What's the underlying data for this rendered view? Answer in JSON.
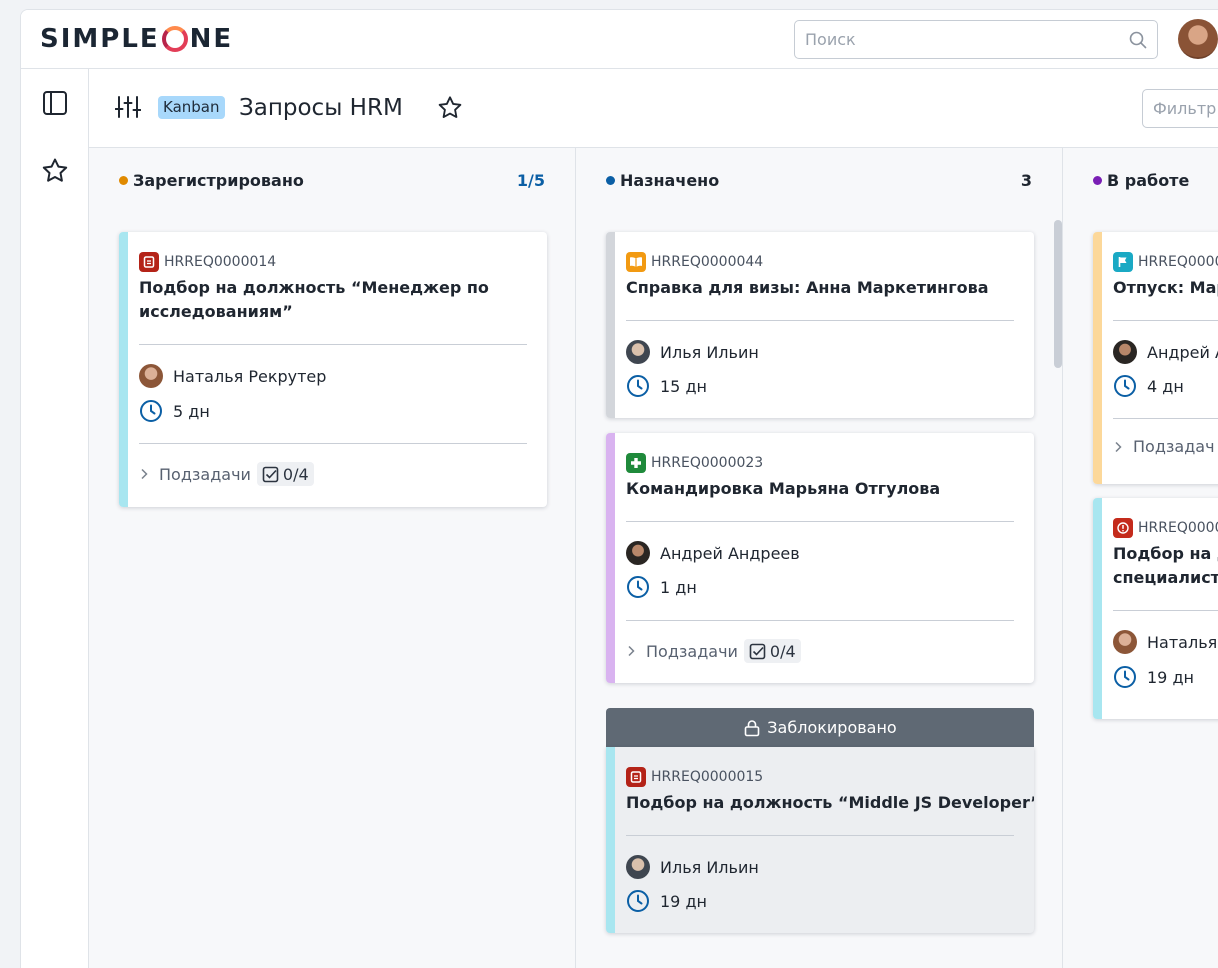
{
  "app": {
    "logo": {
      "part1": "SIMPLE",
      "part2": "NE"
    },
    "search": {
      "placeholder": "Поиск"
    }
  },
  "header": {
    "badge": "Kanban",
    "title": "Запросы HRM",
    "filter_placeholder": "Фильтр"
  },
  "colors": {
    "registered": "#e08a00",
    "assigned": "#0b5fa5",
    "in_progress": "#7a1fb5"
  },
  "columns": [
    {
      "title": "Зарегистрировано",
      "count": "1/5",
      "cards": [
        {
          "id": "HRREQ0000014",
          "title_line1": "Подбор на должность “Менеджер по",
          "title_line2": "исследованиям”",
          "assignee": "Наталья Рекрутер",
          "duration": "5 дн",
          "subtasks_label": "Подзадачи",
          "subtasks_count": "0/4"
        }
      ]
    },
    {
      "title": "Назначено",
      "count": "3",
      "cards": [
        {
          "id": "HRREQ0000044",
          "title": "Справка для визы: Анна Маркетингова",
          "assignee": "Илья Ильин",
          "duration": "15 дн"
        },
        {
          "id": "HRREQ0000023",
          "title": "Командировка Марьяна Отгулова",
          "assignee": "Андрей Андреев",
          "duration": "1 дн",
          "subtasks_label": "Подзадачи",
          "subtasks_count": "0/4"
        },
        {
          "locked_label": "Заблокировано",
          "id": "HRREQ0000015",
          "title": "Подбор на должность “Middle JS Developer”",
          "assignee": "Илья Ильин",
          "duration": "19 дн"
        }
      ]
    },
    {
      "title": "В работе",
      "cards": [
        {
          "id": "HRREQ0000",
          "title": "Отпуск: Мар",
          "assignee": "Андрей А",
          "duration": "4 дн",
          "subtasks_label": "Подзадач"
        },
        {
          "id": "HRREQ0000",
          "title_line1": "Подбор на д",
          "title_line2": "специалист",
          "assignee": "Наталья",
          "duration": "19 дн"
        }
      ]
    }
  ]
}
